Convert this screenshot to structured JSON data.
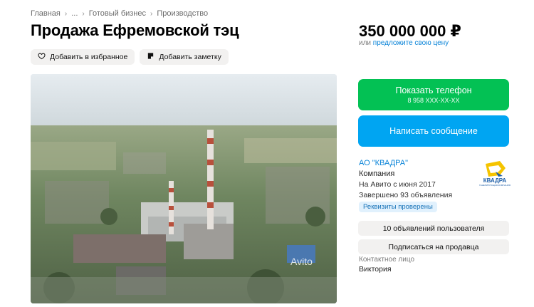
{
  "breadcrumb": {
    "items": [
      "Главная",
      "...",
      "Готовый бизнес",
      "Производство"
    ]
  },
  "listing": {
    "title": "Продажа Ефремовской тэц",
    "price": "350 000 000 ₽",
    "price_or": "или",
    "price_offer_link": "предложите свою цену",
    "photo_watermark": "Avito"
  },
  "actions": {
    "favorite_label": "Добавить в избранное",
    "note_label": "Добавить заметку"
  },
  "contact_buttons": {
    "show_phone_label": "Показать телефон",
    "phone_masked": "8 958 XXX-XX-XX",
    "message_label": "Написать сообщение"
  },
  "seller": {
    "name": "АО \"КВАДРА\"",
    "type": "Компания",
    "since": "На Авито с июня 2017",
    "completed": "Завершено 93 объявления",
    "verified_badge": "Реквизиты проверены",
    "logo_text": "КВАДРА",
    "logo_subtext": "ГЕНЕРИРУЮЩАЯ КОМПАНИЯ"
  },
  "seller_buttons": {
    "listings_label": "10 объявлений пользователя",
    "subscribe_label": "Подписаться на продавца"
  },
  "contact_person": {
    "label": "Контактное лицо",
    "name": "Виктория"
  },
  "colors": {
    "green": "#03c154",
    "blue": "#00a5f2",
    "link": "#0a84d8"
  }
}
